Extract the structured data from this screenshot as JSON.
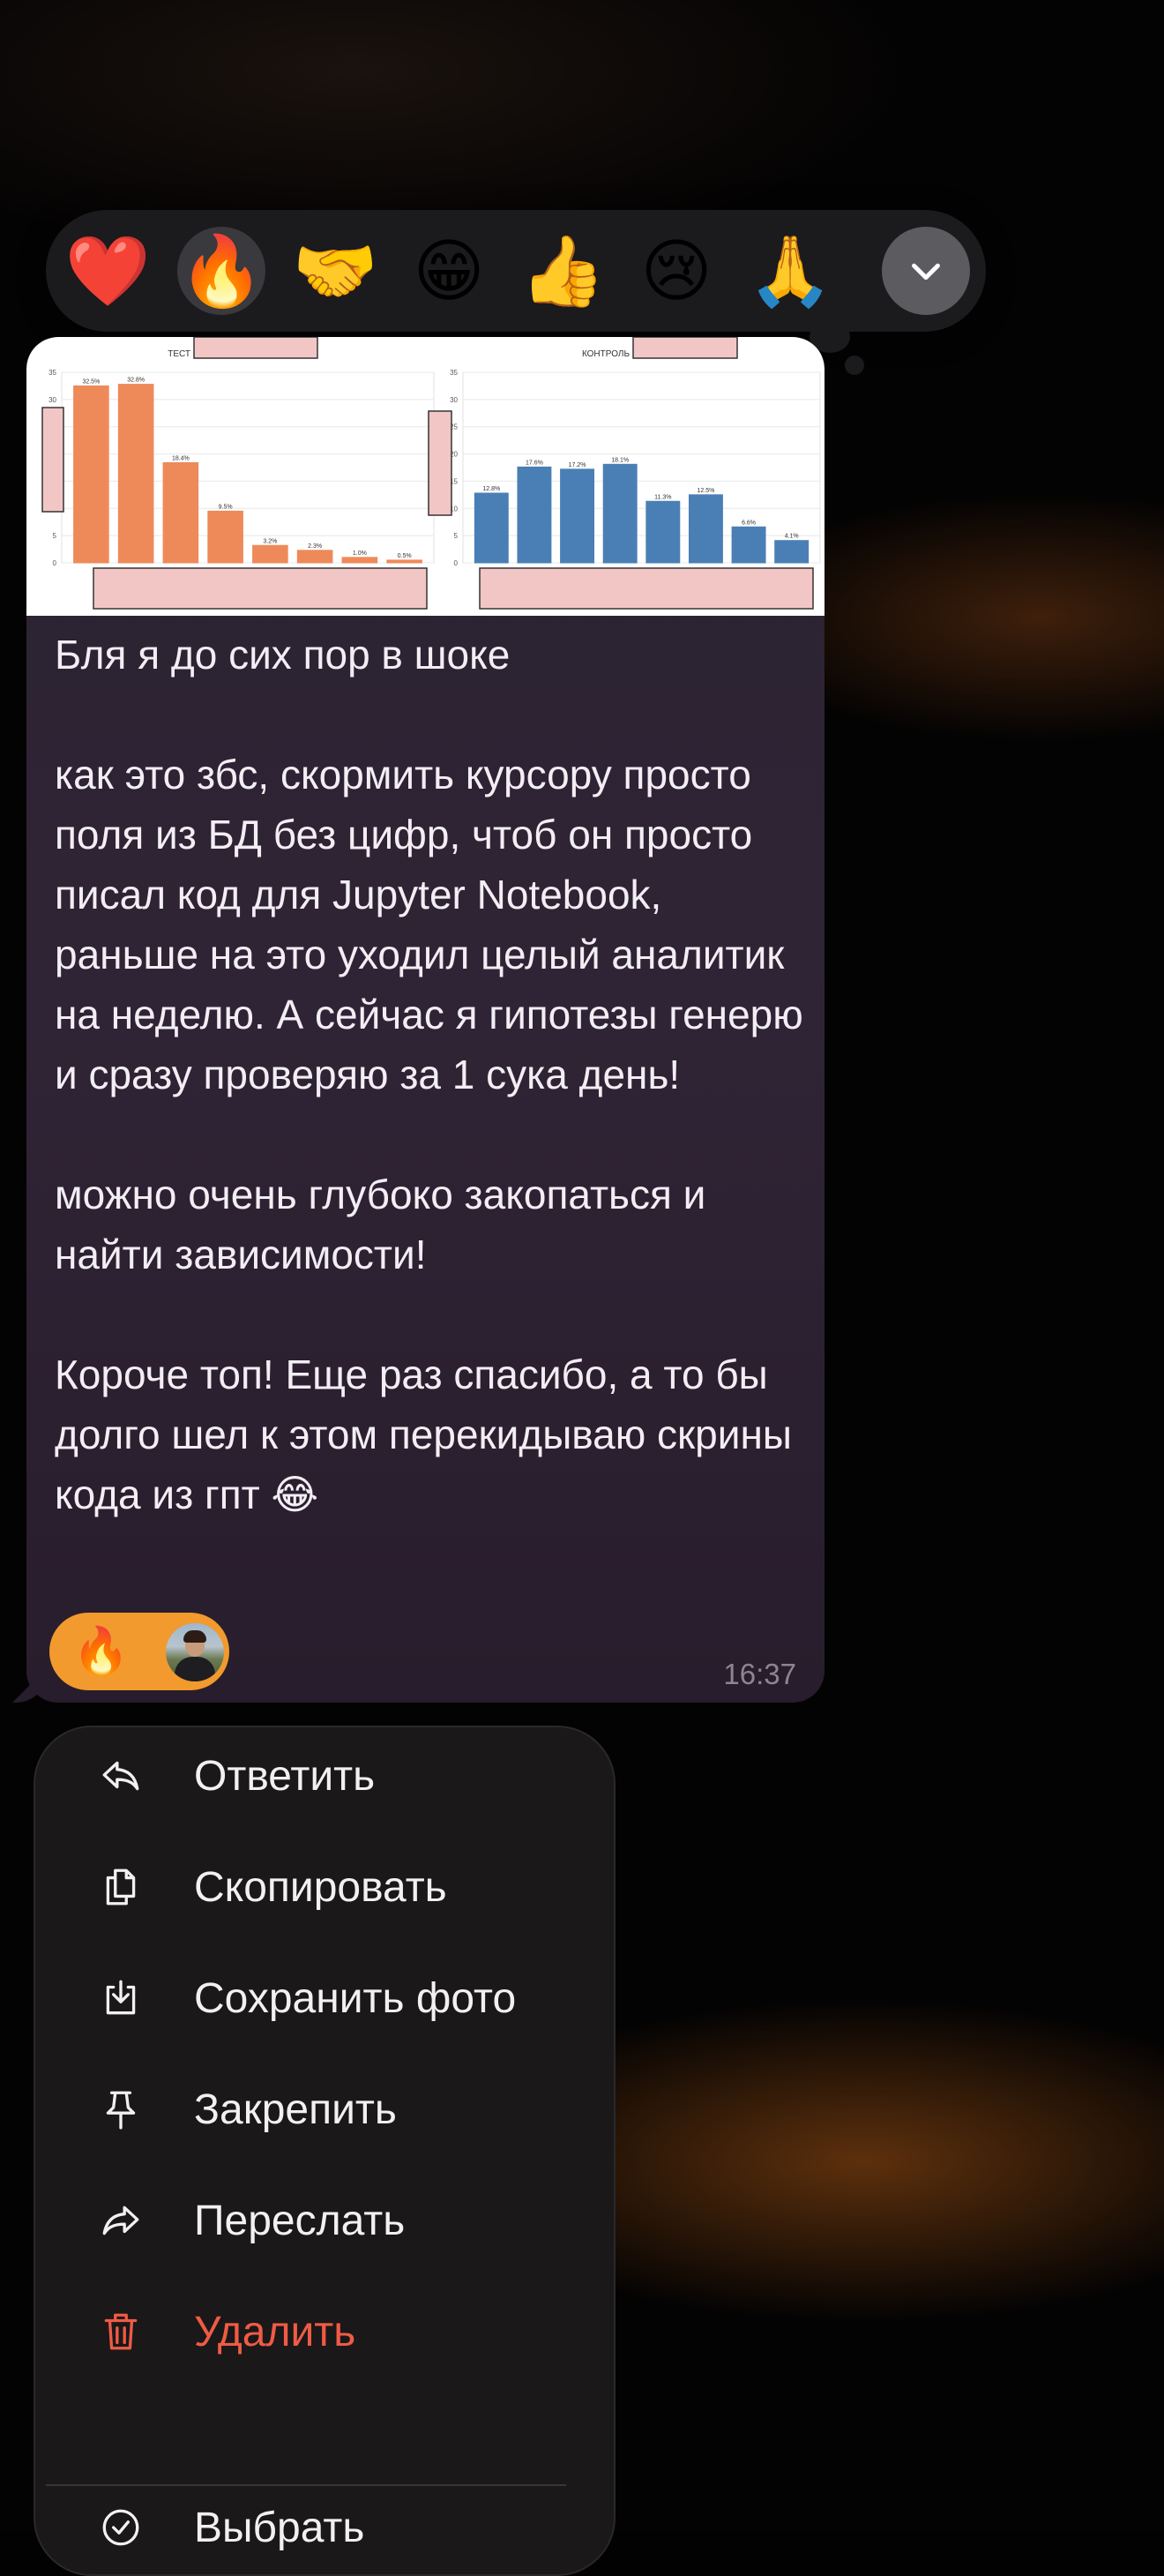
{
  "reactions_bar": {
    "items": [
      {
        "emoji": "❤️",
        "name": "red-heart"
      },
      {
        "emoji": "🔥",
        "name": "fire",
        "selected": true
      },
      {
        "emoji": "🤝",
        "name": "handshake"
      },
      {
        "emoji": "😁",
        "name": "beaming-face"
      },
      {
        "emoji": "👍",
        "name": "thumbs-up"
      },
      {
        "emoji": "😢",
        "name": "crying-face"
      },
      {
        "emoji": "🙏",
        "name": "folded-hands"
      }
    ],
    "more_icon": "chevron-down-icon"
  },
  "message": {
    "photo": {
      "chart_data": [
        {
          "type": "bar",
          "title": "ТЕСТ",
          "yticks": [
            0,
            5,
            10,
            15,
            20,
            25,
            30,
            35
          ],
          "ylim": [
            0,
            35
          ],
          "values": [
            32.5,
            32.8,
            18.4,
            9.5,
            3.2,
            2.3,
            1.0,
            0.5
          ],
          "data_labels": [
            "32.5%",
            "32.8%",
            "18.4%",
            "9.5%",
            "3.2%",
            "2.3%",
            "1.0%",
            "0.5%"
          ],
          "color": "#ee8a5a"
        },
        {
          "type": "bar",
          "title": "КОНТРОЛЬ",
          "yticks": [
            0,
            5,
            10,
            15,
            20,
            25,
            30,
            35
          ],
          "ylim": [
            0,
            35
          ],
          "values": [
            12.8,
            17.6,
            17.2,
            18.1,
            11.3,
            12.5,
            6.6,
            4.1
          ],
          "data_labels": [
            "12.8%",
            "17.6%",
            "17.2%",
            "18.1%",
            "11.3%",
            "12.5%",
            "6.6%",
            "4.1%"
          ],
          "color": "#4a7fb5"
        }
      ]
    },
    "text": "Бля я до сих пор в шоке\n\nкак это збс, скормить курсору просто поля из БД без цифр, чтоб он просто писал код для Jupyter Notebook, раньше на это уходил целый аналитик на неделю. А сейчас я гипотезы генерю и сразу проверяю за 1 сука день!\n\nможно очень глубоко закопаться и найти зависимости!\n\nКороче топ! Еще раз спасибо, а то бы долго шел к этом перекидываю скрины кода из гпт 😂",
    "reaction": {
      "emoji": "🔥"
    },
    "time": "16:37"
  },
  "context_menu": {
    "items": [
      {
        "label": "Ответить",
        "icon": "reply-icon"
      },
      {
        "label": "Скопировать",
        "icon": "copy-icon"
      },
      {
        "label": "Сохранить фото",
        "icon": "save-photo-icon"
      },
      {
        "label": "Закрепить",
        "icon": "pin-icon"
      },
      {
        "label": "Переслать",
        "icon": "forward-icon"
      },
      {
        "label": "Удалить",
        "icon": "trash-icon",
        "danger": true,
        "color": "#ef5b45"
      },
      {
        "label": "Выбрать",
        "icon": "select-icon"
      }
    ]
  },
  "colors": {
    "accent_orange": "#f29a2e",
    "danger": "#ef5b45",
    "bubble": "#2c2132"
  }
}
